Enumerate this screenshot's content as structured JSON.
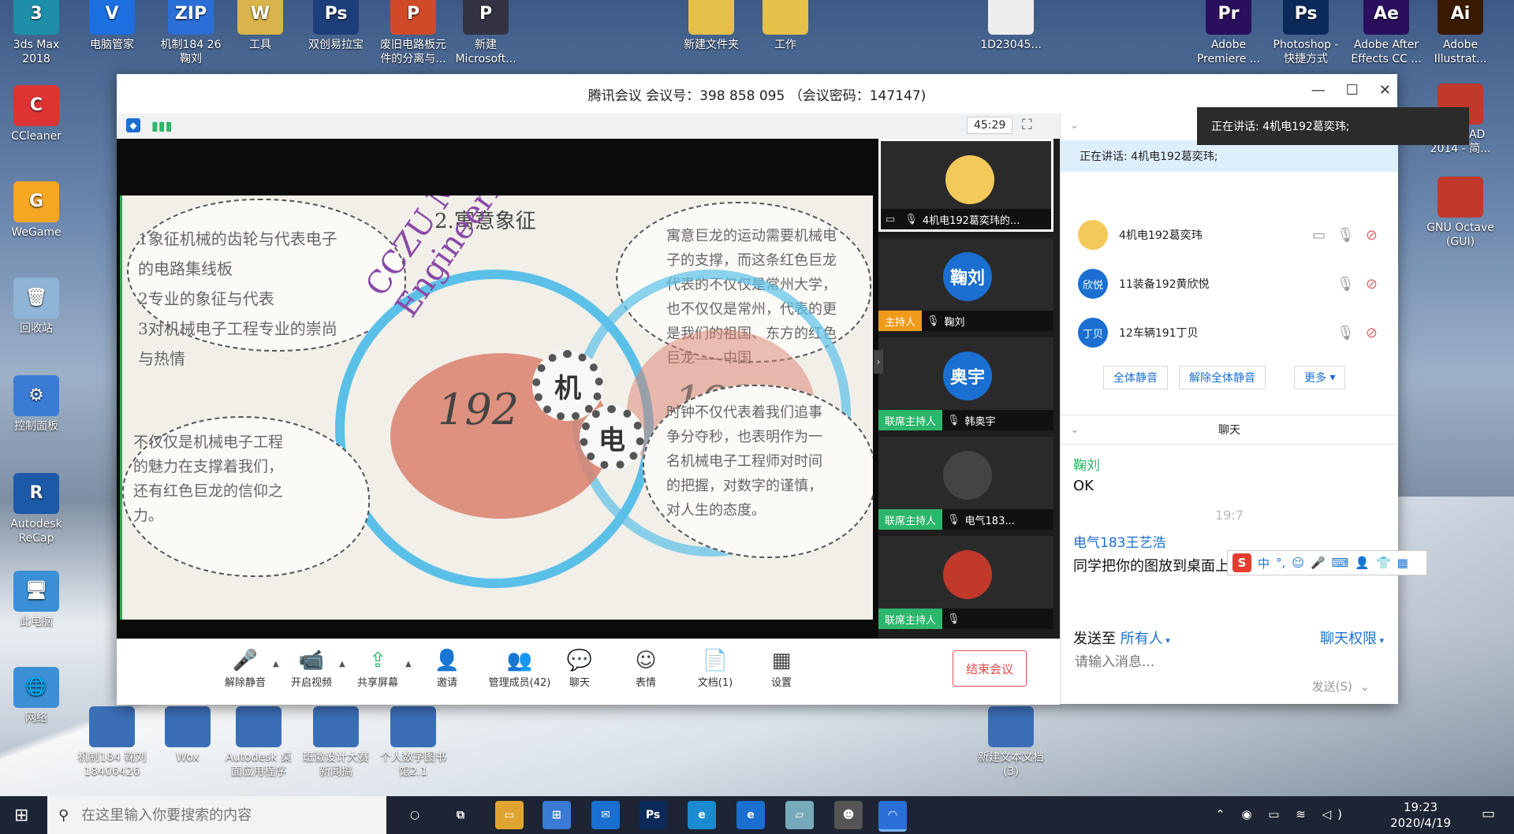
{
  "desktop": {
    "icons_top": [
      {
        "label": "3ds Max\n2018",
        "color": "#1d8fa8",
        "glyph": "3"
      },
      {
        "label": "电脑管家",
        "color": "#1c6fe0",
        "glyph": "V"
      },
      {
        "label": "机制184 26\n鞠刘",
        "color": "#2a6fd8",
        "glyph": "ZIP"
      },
      {
        "label": "工具",
        "color": "#d8b44a",
        "glyph": "W"
      },
      {
        "label": "双创易拉宝",
        "color": "#1c3e7a",
        "glyph": "Ps"
      },
      {
        "label": "废旧电路板元\n件的分离与...",
        "color": "#d04a2a",
        "glyph": "P"
      },
      {
        "label": "新建\nMicrosoft...",
        "color": "#334",
        "glyph": "P"
      },
      {
        "label": "新建文件夹",
        "color": "#e5c14a",
        "glyph": ""
      },
      {
        "label": "工作",
        "color": "#e5c14a",
        "glyph": ""
      },
      {
        "label": "1D23045...",
        "color": "#eee",
        "glyph": ""
      },
      {
        "label": "Adobe\nPremiere ...",
        "color": "#2a0f5e",
        "glyph": "Pr"
      },
      {
        "label": "Photoshop -\n快捷方式",
        "color": "#0b2a5a",
        "glyph": "Ps"
      },
      {
        "label": "Adobe After\nEffects CC ...",
        "color": "#2a0f5e",
        "glyph": "Ae"
      },
      {
        "label": "Adobe\nIllustrat...",
        "color": "#3a1a00",
        "glyph": "Ai"
      }
    ],
    "icons_left": [
      {
        "label": "CCleaner",
        "color": "#d33",
        "glyph": "C"
      },
      {
        "label": "WeGame",
        "color": "#f5a623",
        "glyph": "G"
      },
      {
        "label": "回收站",
        "color": "#8fb4d6",
        "glyph": "🗑"
      },
      {
        "label": "控制面板",
        "color": "#3a7bd5",
        "glyph": "⚙"
      },
      {
        "label": "Autodesk\nReCap",
        "color": "#1c5aa8",
        "glyph": "R"
      },
      {
        "label": "此电脑",
        "color": "#3a8fd5",
        "glyph": "🖥"
      },
      {
        "label": "网络",
        "color": "#3a8fd5",
        "glyph": "🌐"
      }
    ],
    "icons_bottom": [
      {
        "label": "机制184 鞠刘\n18406426"
      },
      {
        "label": "Wox"
      },
      {
        "label": "Autodesk 桌\n面应用程序"
      },
      {
        "label": "班徽设计大赛\n新闻搞"
      },
      {
        "label": "个人数字图书\n馆2.1"
      },
      {
        "label": "新建文本文档\n(3)"
      }
    ],
    "icons_right": [
      {
        "label": "AutoCAD\n2014 - 简..."
      },
      {
        "label": "GNU Octave\n(GUI)"
      }
    ]
  },
  "window": {
    "title": "腾讯会议 会议号：398 858 095 （会议密码：147147)",
    "timer": "45:29"
  },
  "slide": {
    "title": "2.寓意象征",
    "cloud1": [
      "1象征机械的齿轮与代表电子",
      "的电路集线板",
      "2专业的象征与代表",
      "3对机械电子工程专业的崇尚",
      "与热情"
    ],
    "cloud2": [
      "寓意巨龙的运动需要机械电",
      "子的支撑，而这条红色巨龙",
      "代表的不仅仅是常州大学，",
      "也不仅仅是常州，代表的更",
      "是我们的祖国、东方的红色",
      "巨龙——中国"
    ],
    "cloud3": [
      "不仅仅是机械电子工程",
      "的魅力在支撑着我们，",
      "还有红色巨龙的信仰之",
      "力。"
    ],
    "cloud4": [
      "时钟不仅代表着我们追事",
      "争分夺秒，也表明作为一",
      "名机械电子工程师对时间",
      "的把握，对数字的谨慎，",
      "对人生的态度。"
    ],
    "arc_text": "CCZU Mechatronic Engineering",
    "number": "192",
    "gear_char1": "机",
    "gear_char2": "电"
  },
  "tiles": [
    {
      "name": "4机电192葛奕玮的...",
      "role": "",
      "avatar": "",
      "color": "#f3c95a"
    },
    {
      "name": "鞠刘",
      "role": "主持人",
      "avatar": "鞠刘",
      "color": "#1a6fd1"
    },
    {
      "name": "韩奥宇",
      "role": "联席主持人",
      "avatar": "奥宇",
      "color": "#1a6fd1"
    },
    {
      "name": "电气183...",
      "role": "联席主持人",
      "avatar": "",
      "color": "#444"
    },
    {
      "name": "",
      "role": "联席主持人",
      "avatar": "",
      "color": "#c0392b"
    }
  ],
  "bottombar": {
    "buttons": [
      {
        "label": "解除静音",
        "glyph": "🎤"
      },
      {
        "label": "开启视频",
        "glyph": "📹"
      },
      {
        "label": "共享屏幕",
        "glyph": "⇪"
      },
      {
        "label": "邀请",
        "glyph": "👤"
      },
      {
        "label": "管理成员(42)",
        "glyph": "👥"
      },
      {
        "label": "聊天",
        "glyph": "💬"
      },
      {
        "label": "表情",
        "glyph": "☺"
      },
      {
        "label": "文档(1)",
        "glyph": "📄"
      },
      {
        "label": "设置",
        "glyph": "▦"
      }
    ],
    "end_label": "结束会议"
  },
  "panel": {
    "speaker": "正在讲话: 4机电192葛奕玮;",
    "members": [
      {
        "name": "4机电192葛奕玮",
        "avatar": "",
        "color": "#f3c95a"
      },
      {
        "name": "11装备192黄欣悦",
        "avatar": "欣悦",
        "color": "#1a6fd1"
      },
      {
        "name": "12车辆191丁贝",
        "avatar": "丁贝",
        "color": "#1a6fd1"
      }
    ],
    "mute_all": "全体静音",
    "unmute_all": "解除全体静音",
    "more": "更多",
    "chat_title": "聊天",
    "chat": [
      {
        "name": "鞠刘",
        "msg": "OK"
      },
      {
        "time": "19:7"
      },
      {
        "name": "电气183王艺浩",
        "msg": "同学把你的图放到桌面上"
      }
    ],
    "send_to_label": "发送至",
    "send_to_value": "所有人",
    "chat_perm": "聊天权限",
    "input_placeholder": "请输入消息...",
    "send": "发送(S)"
  },
  "popup": "正在讲话: 4机电192葛奕玮;",
  "ime": [
    "中",
    "°,",
    "☺",
    "🎤",
    "⌨",
    "👤",
    "👕",
    "▦"
  ],
  "taskbar": {
    "search_placeholder": "在这里输入你要搜索的内容",
    "time": "19:23",
    "date": "2020/4/19"
  }
}
